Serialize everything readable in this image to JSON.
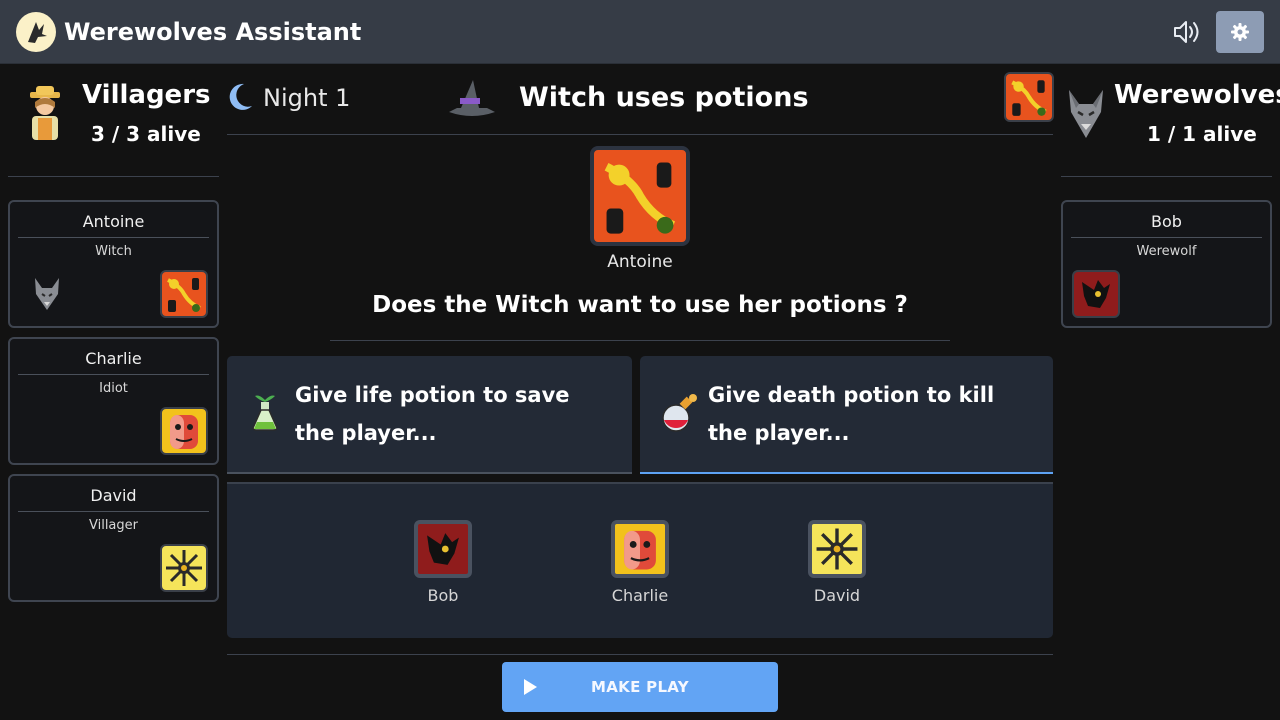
{
  "app": {
    "title": "Werewolves Assistant"
  },
  "header": {
    "sound_icon": "speaker-icon",
    "settings_icon": "gear-icon"
  },
  "villagers": {
    "name": "Villagers",
    "alive": "3 / 3 alive",
    "players": [
      {
        "name": "Antoine",
        "role": "Witch"
      },
      {
        "name": "Charlie",
        "role": "Idiot"
      },
      {
        "name": "David",
        "role": "Villager"
      }
    ]
  },
  "werewolves": {
    "name": "Werewolves",
    "alive": "1 / 1 alive",
    "players": [
      {
        "name": "Bob",
        "role": "Werewolf"
      }
    ]
  },
  "phase": {
    "night_label": "Night 1",
    "title": "Witch uses potions",
    "focus_player": "Antoine",
    "question": "Does the Witch want to use her potions ?"
  },
  "actions": {
    "life": "Give life potion to save the player...",
    "death": "Give death potion to kill the player..."
  },
  "targets": [
    {
      "name": "Bob"
    },
    {
      "name": "Charlie"
    },
    {
      "name": "David"
    }
  ],
  "play_button": {
    "label": "MAKE PLAY"
  },
  "colors": {
    "background": "#121212",
    "topbar": "#363c46",
    "accent": "#62a4f4",
    "panel": "#232a36",
    "witch_tile": "#e8531e",
    "werewolf_tile": "#8f1c1c",
    "idiot_tile": "#f2c21c",
    "villager_tile": "#f5e45a"
  }
}
